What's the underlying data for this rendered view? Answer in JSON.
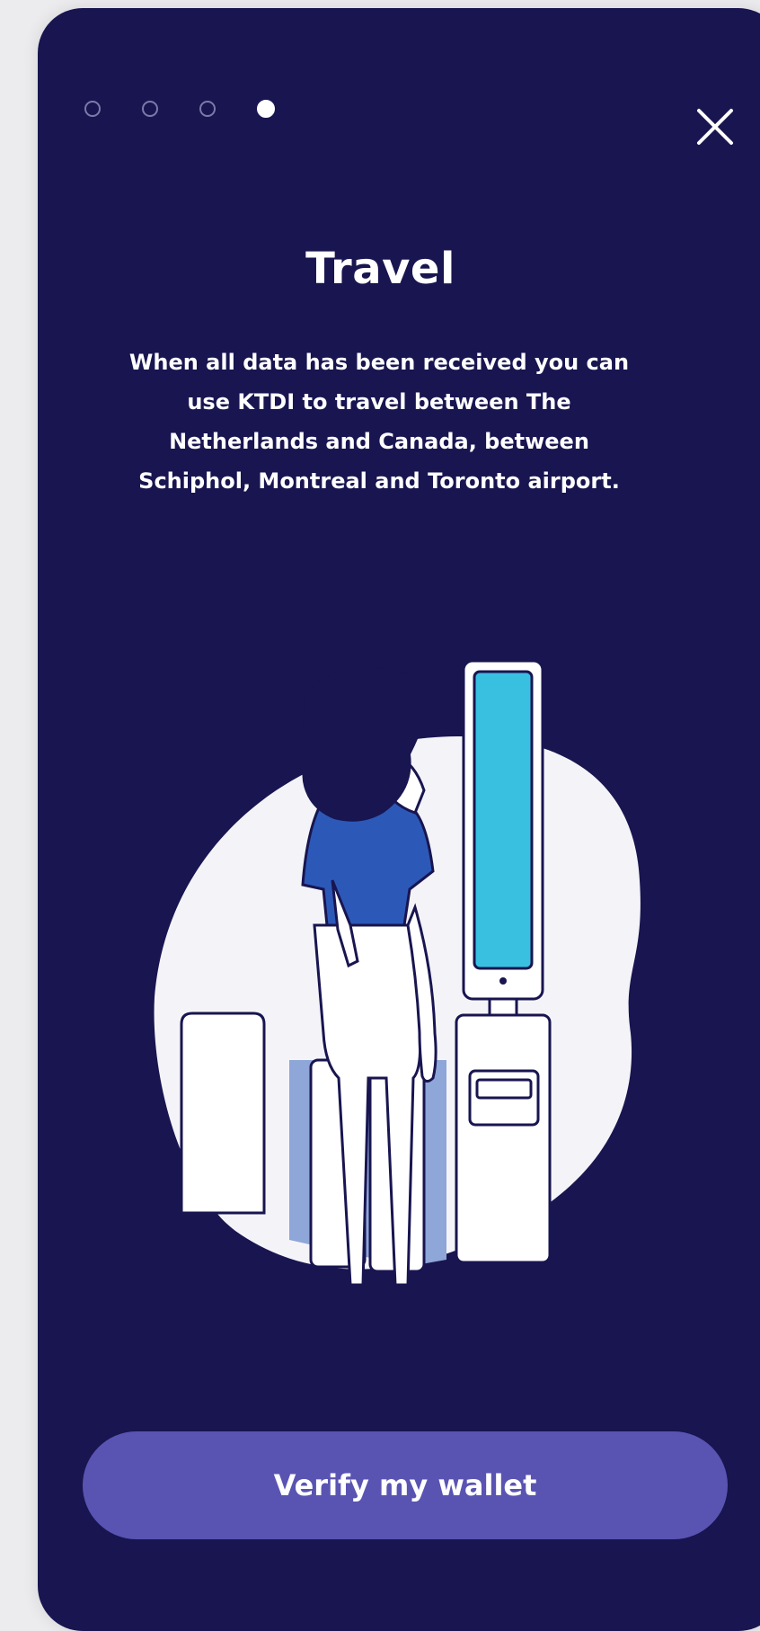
{
  "onboarding": {
    "current_step": 4,
    "total_steps": 4,
    "title": "Travel",
    "description": "When all data has been received you can use KTDI to travel between The Netherlands and Canada, between Schiphol, Montreal and Toronto airport.",
    "close_icon": "close-icon"
  },
  "actions": {
    "verify_label": "Verify my wallet"
  },
  "colors": {
    "background": "#181550",
    "accent": "#5954b2",
    "kiosk_screen": "#39c0e1",
    "shirt": "#2c59b8",
    "floor_shadow": "#8ea6d8"
  }
}
